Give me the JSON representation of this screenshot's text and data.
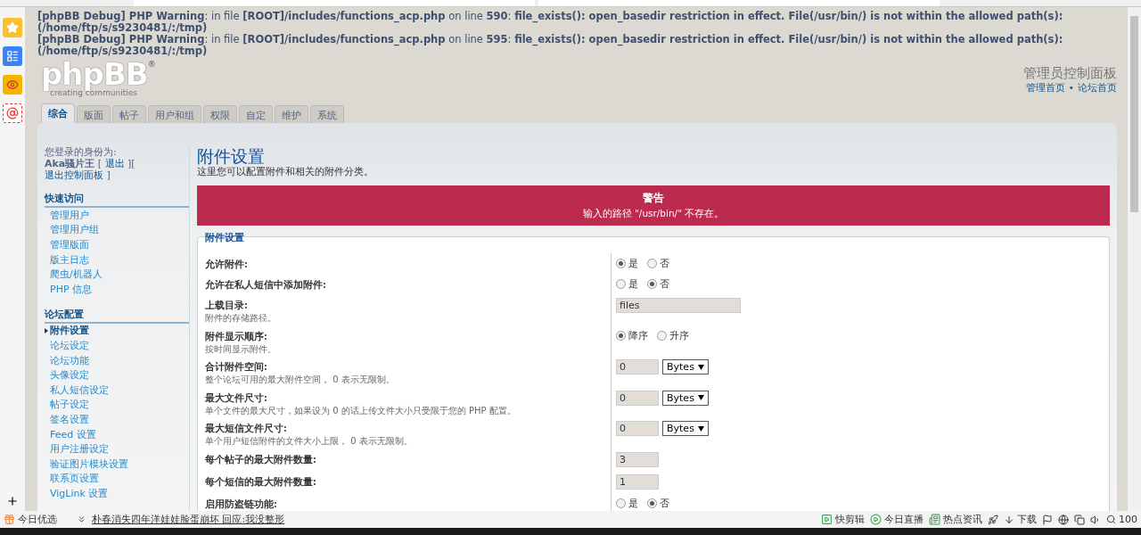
{
  "debug_messages": [
    "**[phpBB Debug] PHP Warning**: in file **[ROOT]/includes/functions_acp.php** on line **590**: **file_exists(): open_basedir restriction in effect. File(/usr/bin/) is not within the allowed path(s): (/home/ftp/s/s9230481/:/tmp)**",
    "**[phpBB Debug] PHP Warning**: in file **[ROOT]/includes/functions_acp.php** on line **595**: **file_exists(): open_basedir restriction in effect. File(/usr/bin/) is not within the allowed path(s): (/home/ftp/s/s9230481/:/tmp)**"
  ],
  "logo": {
    "name": "phpBB",
    "mark": "®",
    "tagline": "creating communities"
  },
  "header": {
    "title": "管理员控制面板",
    "links": [
      "管理首页",
      "论坛首页"
    ],
    "separator": "•"
  },
  "tabs": [
    {
      "label": "综合",
      "selected": true
    },
    {
      "label": "版面",
      "selected": false
    },
    {
      "label": "帖子",
      "selected": false
    },
    {
      "label": "用户和组",
      "selected": false
    },
    {
      "label": "权限",
      "selected": false
    },
    {
      "label": "自定",
      "selected": false
    },
    {
      "label": "维护",
      "selected": false
    },
    {
      "label": "系统",
      "selected": false
    }
  ],
  "sidebar": {
    "login_label": "您登录的身份为:",
    "user": "Aka骚片王",
    "bracket_open": "[",
    "bracket_close": "]",
    "user_links": [
      "退出",
      "退出控制面板"
    ],
    "sections": [
      {
        "title": "快速访问",
        "items": [
          {
            "label": "管理用户",
            "selected": false
          },
          {
            "label": "管理用户组",
            "selected": false
          },
          {
            "label": "管理版面",
            "selected": false
          },
          {
            "label": "版主日志",
            "selected": false
          },
          {
            "label": "爬虫/机器人",
            "selected": false
          },
          {
            "label": "PHP 信息",
            "selected": false
          }
        ]
      },
      {
        "title": "论坛配置",
        "items": [
          {
            "label": "附件设置",
            "selected": true
          },
          {
            "label": "论坛设定",
            "selected": false
          },
          {
            "label": "论坛功能",
            "selected": false
          },
          {
            "label": "头像设定",
            "selected": false
          },
          {
            "label": "私人短信设定",
            "selected": false
          },
          {
            "label": "帖子设定",
            "selected": false
          },
          {
            "label": "签名设置",
            "selected": false
          },
          {
            "label": "Feed 设置",
            "selected": false
          },
          {
            "label": "用户注册设定",
            "selected": false
          },
          {
            "label": "验证图片模块设置",
            "selected": false
          },
          {
            "label": "联系页设置",
            "selected": false
          },
          {
            "label": "VigLink 设置",
            "selected": false
          }
        ]
      }
    ]
  },
  "main": {
    "title": "附件设置",
    "description": "这里您可以配置附件和相关的附件分类。",
    "warning": {
      "title": "警告",
      "message": "输入的路径 \"/usr/bin/\" 不存在。"
    },
    "fieldset": {
      "legend": "附件设置",
      "rows": [
        {
          "label": "允许附件:",
          "kind": "radio",
          "options": [
            {
              "label": "是",
              "selected": true
            },
            {
              "label": "否",
              "selected": false
            }
          ]
        },
        {
          "label": "允许在私人短信中添加附件:",
          "kind": "radio",
          "options": [
            {
              "label": "是",
              "selected": false
            },
            {
              "label": "否",
              "selected": true
            }
          ]
        },
        {
          "label": "上载目录:",
          "description": "附件的存储路径。",
          "kind": "text",
          "value": "files"
        },
        {
          "label": "附件显示顺序:",
          "description": "按时间显示附件。",
          "kind": "radio",
          "options": [
            {
              "label": "降序",
              "selected": true
            },
            {
              "label": "升序",
              "selected": false
            }
          ]
        },
        {
          "label": "合计附件空间:",
          "description": "整个论坛可用的最大附件空间， 0 表示无限制。",
          "kind": "size",
          "value": "0",
          "unit": "Bytes"
        },
        {
          "label": "最大文件尺寸:",
          "description": "单个文件的最大尺寸，如果设为 0 的话上传文件大小只受限于您的 PHP 配置。",
          "kind": "size",
          "value": "0",
          "unit": "Bytes"
        },
        {
          "label": "最大短信文件尺寸:",
          "description": "单个用户短信附件的文件大小上限， 0 表示无限制。",
          "kind": "size",
          "value": "0",
          "unit": "Bytes"
        },
        {
          "label": "每个帖子的最大附件数量:",
          "kind": "number",
          "value": "3"
        },
        {
          "label": "每个短信的最大附件数量:",
          "kind": "number",
          "value": "1"
        },
        {
          "label": "启用防盗链功能:",
          "kind": "radio",
          "options": [
            {
              "label": "是",
              "selected": false
            },
            {
              "label": "否",
              "selected": true
            }
          ]
        }
      ]
    }
  },
  "status_bar": {
    "left": "今日优选",
    "news": "朴春消失四年洋娃娃脸蛋崩坏 回应:我没整形",
    "items": [
      "快剪辑",
      "今日直播",
      "热点资讯"
    ],
    "download": "下载",
    "zoom": "100"
  }
}
